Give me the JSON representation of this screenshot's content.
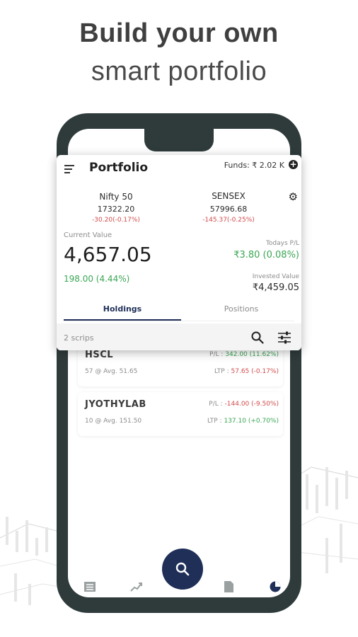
{
  "headline": {
    "line1": "Build your own",
    "line2": "smart portfolio"
  },
  "portfolio": {
    "title": "Portfolio",
    "funds": "Funds: ₹ 2.02 K",
    "indices": [
      {
        "name": "Nifty 50",
        "value": "17322.20",
        "change": "-30.20(-0.17%)"
      },
      {
        "name": "SENSEX",
        "value": "57996.68",
        "change": "-145.37(-0.25%)"
      }
    ],
    "current_value_label": "Current Value",
    "current_value": "4,657.05",
    "gain": "198.00 (4.44%)",
    "todays_pl_label": "Todays P/L",
    "todays_pl_value": "₹3.80 (0.08%)",
    "invested_label": "Invested Value",
    "invested_value": "₹4,459.05",
    "tabs": [
      "Holdings",
      "Positions"
    ],
    "scrips": "2 scrips"
  },
  "holdings": [
    {
      "name": "HSCL",
      "qty_avg": "57 @ Avg. 51.65",
      "pl_label": "P/L :",
      "pl": "342.00 (11.62%)",
      "ltp_label": "LTP :",
      "ltp": "57.65 (-0.17%)"
    },
    {
      "name": "JYOTHYLAB",
      "qty_avg": "10 @ Avg. 151.50",
      "pl_label": "P/L :",
      "pl": "-144.00 (-9.50%)",
      "ltp_label": "LTP :",
      "ltp": "137.10 (+0.70%)"
    }
  ],
  "colors": {
    "phone": "#2f3b3b",
    "accent": "#1f2f58",
    "gain": "#3aa655",
    "loss": "#d24b4b"
  },
  "icons": [
    "menu-icon",
    "plus-circle-icon",
    "gear-icon",
    "search-icon",
    "filter-icon",
    "list-icon",
    "trend-icon",
    "document-icon",
    "pie-chart-icon"
  ]
}
